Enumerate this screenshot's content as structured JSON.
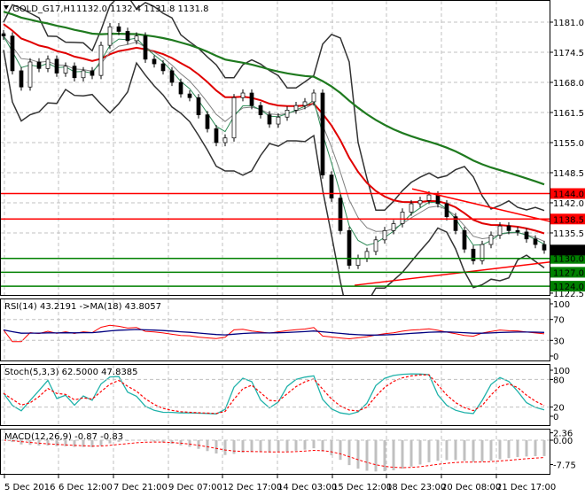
{
  "header": {
    "symbol": "GOLD_G17,H1",
    "ohlc": "1132.0 1132.4 1131.8 1131.8"
  },
  "colors": {
    "bull": "#2e7d32",
    "ma_long": "#1f7a1f",
    "ma_mid": "#e00000",
    "bands": "#333333",
    "level_red": "#ff0000",
    "level_green": "#008000",
    "rsi": "#ff0000",
    "rsi_ma": "#000080",
    "stoch_main": "#20b2aa",
    "stoch_signal": "#ff0000",
    "macd_hist": "#c0c0c0",
    "macd_signal": "#ff0000"
  },
  "chart_data": [
    {
      "type": "candlestick",
      "title": "GOLD_G17,H1",
      "ylim": [
        1122.5,
        1184
      ],
      "yticks": [
        "1181.0",
        "1174.5",
        "1168.0",
        "1161.5",
        "1155.0",
        "1148.5",
        "1142.0",
        "1135.5",
        "1122.5"
      ],
      "xticks": [
        "5 Dec 2016",
        "6 Dec 12:00",
        "7 Dec 21:00",
        "9 Dec 07:00",
        "12 Dec 17:00",
        "14 Dec 03:00",
        "15 Dec 12:00",
        "18 Dec 23:00",
        "20 Dec 08:00",
        "21 Dec 17:00"
      ],
      "close": [
        1178,
        1170.5,
        1167,
        1172.4,
        1171,
        1173,
        1170,
        1171.5,
        1169,
        1170.5,
        1169.5,
        1176,
        1180,
        1179,
        1177,
        1178,
        1173,
        1172,
        1170.5,
        1168,
        1165.5,
        1164.7,
        1161,
        1158,
        1155,
        1156,
        1164.7,
        1165.7,
        1163,
        1161,
        1159,
        1160.5,
        1162,
        1163,
        1163.8,
        1165.7,
        1148,
        1143,
        1136,
        1128.5,
        1130,
        1131.5,
        1134,
        1136,
        1137.5,
        1140,
        1141.8,
        1142.5,
        1143.7,
        1141.8,
        1139,
        1136,
        1132,
        1129.5,
        1133,
        1135,
        1137,
        1136,
        1135.7,
        1134.2,
        1133,
        1131.8
      ],
      "levels": [
        {
          "value": 1144.0,
          "label": "1144.0",
          "color": "red"
        },
        {
          "value": 1138.5,
          "label": "1138.5",
          "color": "red"
        },
        {
          "value": 1130.0,
          "label": "1130.0",
          "color": "green"
        },
        {
          "value": 1127.0,
          "label": "1127.0",
          "color": "green"
        },
        {
          "value": 1124.0,
          "label": "1124.0",
          "color": "green"
        }
      ],
      "current_price": "1131.8"
    },
    {
      "type": "line",
      "title": "RSI(14) 43.2191  ->MA(18) 43.8057",
      "ylim": [
        0,
        100
      ],
      "yticks": [
        "100",
        "70",
        "30",
        "0"
      ]
    },
    {
      "type": "line",
      "title": "Stoch(5,3,3) 62.5000 47.8385",
      "ylim": [
        0,
        100
      ],
      "yticks": [
        "100",
        "80",
        "20",
        "0"
      ]
    },
    {
      "type": "bar",
      "title": "MACD(12,26,9) -0.87 -0.83",
      "ylim": [
        -7.75,
        2.36
      ],
      "yticks": [
        "2.36",
        "0.00",
        "-7.75"
      ]
    }
  ]
}
